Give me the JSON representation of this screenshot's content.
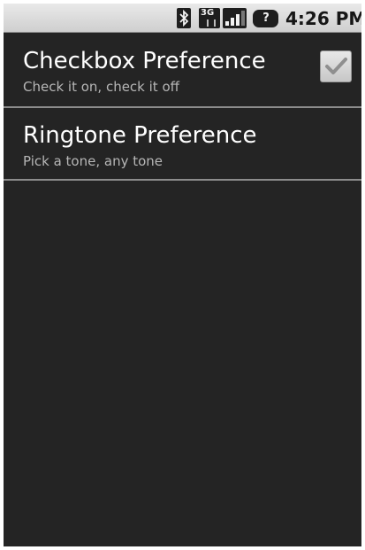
{
  "status_bar": {
    "time": "4:26 PM",
    "network_label": "3G",
    "icons": [
      "bluetooth-icon",
      "3g-data-icon",
      "signal-strength-icon",
      "sim-unknown-icon"
    ]
  },
  "preferences": [
    {
      "title": "Checkbox Preference",
      "summary": "Check it on, check it off",
      "control": "checkbox",
      "checked": true
    },
    {
      "title": "Ringtone Preference",
      "summary": "Pick a tone, any tone"
    }
  ],
  "colors": {
    "background": "#242424",
    "title_text": "#ffffff",
    "summary_text": "#b6b6b6",
    "status_bar": "#dcdcdc"
  }
}
